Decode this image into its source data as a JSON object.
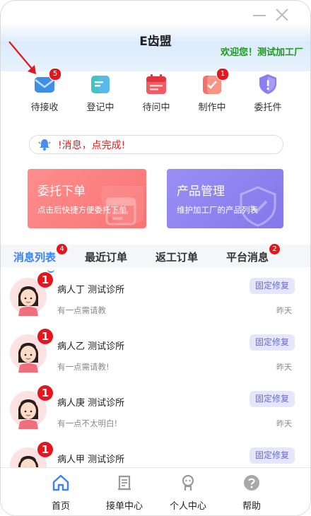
{
  "app": {
    "title": "E齿盟",
    "welcome": "欢迎您！测试加工厂"
  },
  "colors": {
    "accent": "#3b82f6",
    "badge": "#e4161c",
    "welcome": "#1a9a1a",
    "notice": "#e02020"
  },
  "shortcuts": [
    {
      "label": "待接收",
      "icon": "envelope-icon",
      "badge": "5"
    },
    {
      "label": "登记中",
      "icon": "document-icon",
      "badge": ""
    },
    {
      "label": "待问中",
      "icon": "calendar-icon",
      "badge": ""
    },
    {
      "label": "制作中",
      "icon": "task-check-icon",
      "badge": "1"
    },
    {
      "label": "委托件",
      "icon": "shield-icon",
      "badge": ""
    }
  ],
  "notice": {
    "text": "!消息，点完成!",
    "icon": "bell-icon"
  },
  "cards": [
    {
      "title": "委托下单",
      "subtitle": "点击后快捷方便委托下单"
    },
    {
      "title": "产品管理",
      "subtitle": "维护加工厂的产品列表"
    }
  ],
  "tabs": [
    {
      "label": "消息列表",
      "badge": "4"
    },
    {
      "label": "最近订单",
      "badge": ""
    },
    {
      "label": "返工订单",
      "badge": ""
    },
    {
      "label": "平台消息",
      "badge": "2"
    }
  ],
  "messages": [
    {
      "name": "病人丁 测试诊所",
      "message": "有一点需请教",
      "tag": "固定修复",
      "time": "昨天",
      "count": "1"
    },
    {
      "name": "病人乙 测试诊所",
      "message": "有一点需请教!",
      "tag": "固定修复",
      "time": "昨天",
      "count": "1"
    },
    {
      "name": "病人庚 测试诊所",
      "message": "有一点不太明白!",
      "tag": "固定修复",
      "time": "昨天",
      "count": "1"
    },
    {
      "name": "病人甲 测试诊所",
      "message": "",
      "tag": "固定修复",
      "time": "",
      "count": "1"
    }
  ],
  "nav": [
    {
      "label": "首页",
      "icon": "home-icon"
    },
    {
      "label": "接单中心",
      "icon": "order-scroll-icon"
    },
    {
      "label": "个人中心",
      "icon": "person-icon"
    },
    {
      "label": "帮助",
      "icon": "help-icon"
    }
  ]
}
